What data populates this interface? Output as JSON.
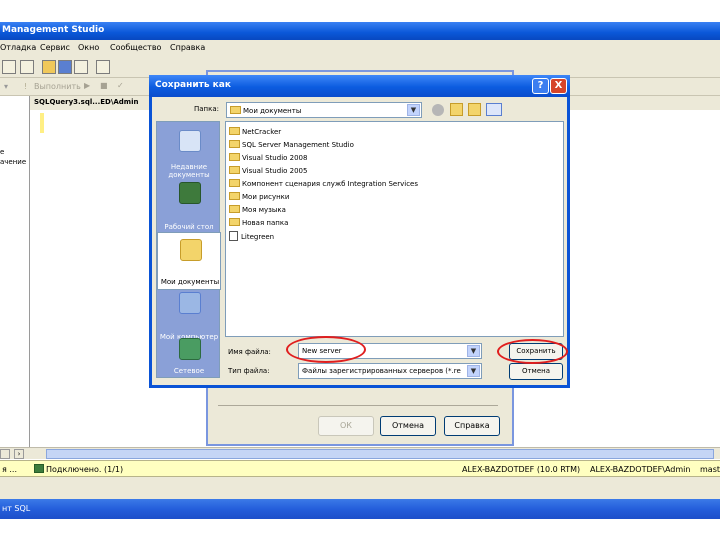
{
  "main_window": {
    "title": "Management Studio",
    "menu": [
      "Отладка",
      "Сервис",
      "Окно",
      "Сообщество",
      "Справка"
    ],
    "toolbar2_execute": "Выполнить",
    "doc_tab": "SQLQuery3.sql...ED\\Admin",
    "left_panel_items": [
      "е",
      "ачение"
    ],
    "statusbar": {
      "left": "я ...",
      "message": "Подключено. (1/1)",
      "server": "ALEX-BAZDOTDEF (10.0 RTM)",
      "user": "ALEX-BAZDOTDEF\\Admin",
      "db": "maste"
    },
    "taskbar_item": "нт SQL"
  },
  "bg_dialog": {
    "ok": "ОК",
    "cancel": "Отмена",
    "help": "Справка"
  },
  "save_dialog": {
    "title": "Сохранить как",
    "folder_label": "Папка:",
    "folder_value": "Мои документы",
    "places": [
      "Недавние документы",
      "Рабочий стол",
      "Мои документы",
      "Мой компьютер",
      "Сетевое"
    ],
    "files": [
      {
        "name": "NetCracker",
        "type": "folder"
      },
      {
        "name": "SQL Server Management Studio",
        "type": "folder"
      },
      {
        "name": "Visual Studio 2008",
        "type": "folder"
      },
      {
        "name": "Visual Studio 2005",
        "type": "folder"
      },
      {
        "name": "Компонент сценария служб Integration Services",
        "type": "folder"
      },
      {
        "name": "Мои рисунки",
        "type": "folder"
      },
      {
        "name": "Моя музыка",
        "type": "folder"
      },
      {
        "name": "Новая папка",
        "type": "folder"
      },
      {
        "name": "Litegreen",
        "type": "file"
      }
    ],
    "filename_label": "Имя файла:",
    "filename_value": "New server",
    "filetype_label": "Тип файла:",
    "filetype_value": "Файлы зарегистрированных серверов (*.re",
    "save_button": "Сохранить",
    "cancel_button": "Отмена",
    "help_button": "?",
    "close_button": "X"
  },
  "colors": {
    "titlebar": "#0a57d8",
    "highlight": "#e01e1e",
    "dialog_bg": "#ece9d8"
  }
}
